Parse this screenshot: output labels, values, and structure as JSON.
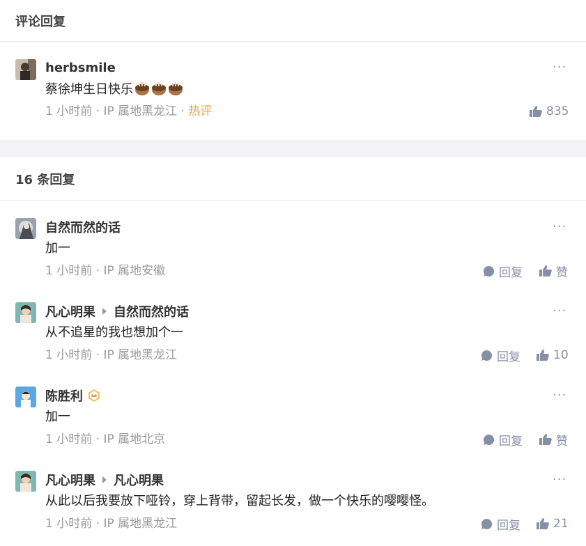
{
  "header": {
    "title": "评论回复"
  },
  "root_comment": {
    "author": "herbsmile",
    "content": "蔡徐坤生日快乐",
    "emojis": [
      "cake-icon",
      "cake-icon",
      "cake-icon"
    ],
    "time": "1 小时前",
    "location": "IP 属地黑龙江",
    "hot_label": "热评",
    "likes": "835",
    "separator": "·"
  },
  "replies_header": {
    "title": "16 条回复"
  },
  "replies": [
    {
      "author": "自然而然的话",
      "reply_to": "",
      "content": "加一",
      "time": "1 小时前",
      "location": "IP 属地安徽",
      "reply_label": "回复",
      "like_label": "赞"
    },
    {
      "author": "凡心明果",
      "reply_to": "自然而然的话",
      "content": "从不追星的我也想加个一",
      "time": "1 小时前",
      "location": "IP 属地黑龙江",
      "reply_label": "回复",
      "like_label": "10"
    },
    {
      "author": "陈胜利",
      "reply_to": "",
      "content": "加一",
      "time": "1 小时前",
      "location": "IP 属地北京",
      "reply_label": "回复",
      "like_label": "赞"
    },
    {
      "author": "凡心明果",
      "reply_to": "凡心明果",
      "content": "从此以后我要放下哑铃，穿上背带，留起长发，做一个快乐的嘤嘤怪。",
      "time": "1 小时前",
      "location": "IP 属地黑龙江",
      "reply_label": "回复",
      "like_label": "21"
    }
  ],
  "more_label": "···",
  "colors": {
    "muted": "#999999",
    "action": "#8590a6",
    "hot": "#f1a33d",
    "gap": "#f2f3f5"
  }
}
